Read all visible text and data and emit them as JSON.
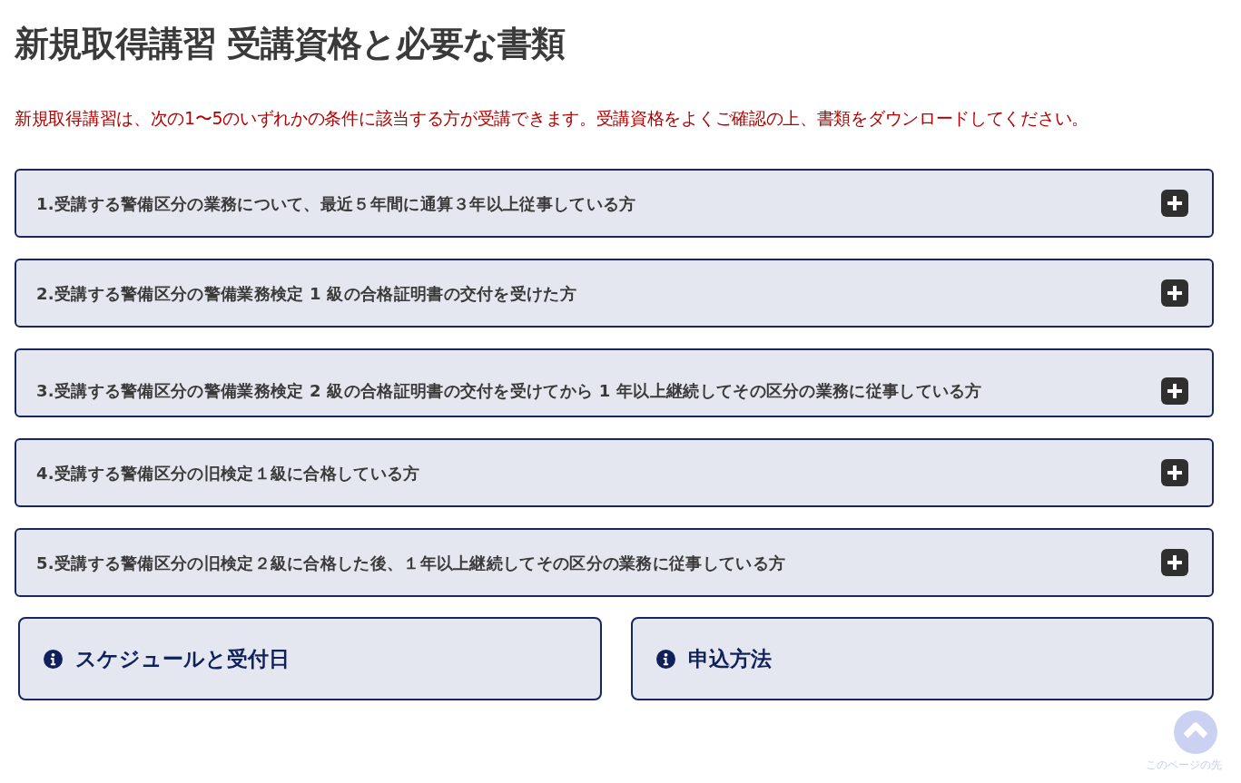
{
  "title": "新規取得講習 受講資格と必要な書類",
  "intro": "新規取得講習は、次の1〜5のいずれかの条件に該当する方が受講できます。受講資格をよくご確認の上、書類をダウンロードしてください。",
  "accordion": [
    {
      "label": "1.受講する警備区分の業務について、最近５年間に通算３年以上従事している方",
      "expanded": false
    },
    {
      "label": "2.受講する警備区分の警備業務検定 1 級の合格証明書の交付を受けた方",
      "expanded": false
    },
    {
      "label": "3.受講する警備区分の警備業務検定 2 級の合格証明書の交付を受けてから 1 年以上継続してその区分の業務に従事している方",
      "expanded": false
    },
    {
      "label": "4.受講する警備区分の旧検定１級に合格している方",
      "expanded": false
    },
    {
      "label": "5.受講する警備区分の旧検定２級に合格した後、１年以上継続してその区分の業務に従事している方",
      "expanded": false
    }
  ],
  "links": [
    {
      "label": "スケジュールと受付日"
    },
    {
      "label": "申込方法"
    }
  ],
  "back_to_top": {
    "label": "このページの先"
  }
}
